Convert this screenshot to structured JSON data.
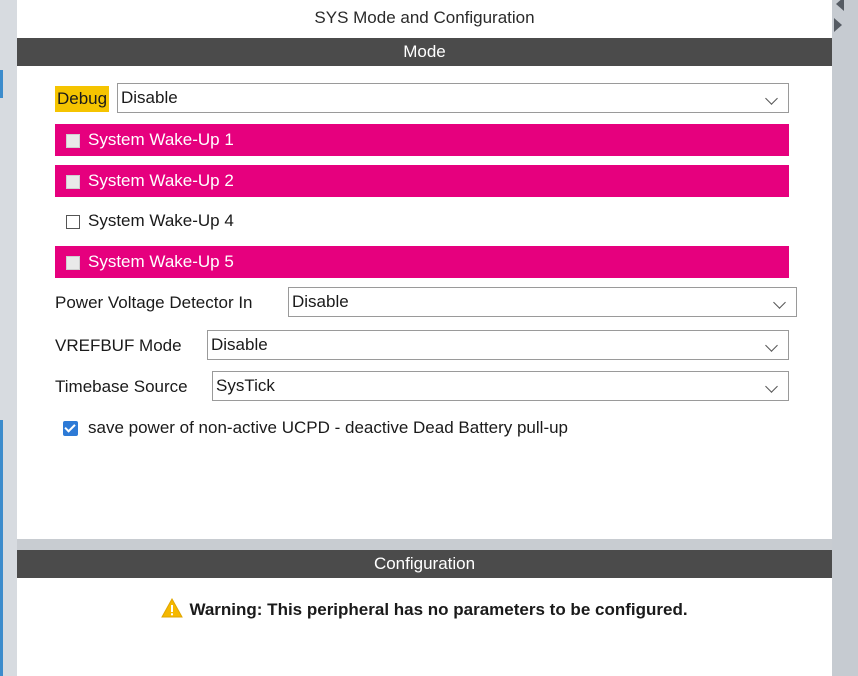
{
  "panel": {
    "title": "SYS Mode and Configuration"
  },
  "mode_section": {
    "title": "Mode"
  },
  "debug": {
    "label": "Debug",
    "value": "Disable"
  },
  "wakeups": [
    {
      "label": "System Wake-Up 1",
      "state": "highlighted"
    },
    {
      "label": "System Wake-Up 2",
      "state": "highlighted"
    },
    {
      "label": "System Wake-Up 4",
      "state": "unchecked"
    },
    {
      "label": "System Wake-Up 5",
      "state": "highlighted"
    }
  ],
  "pvd": {
    "label": "Power Voltage Detector In",
    "value": "Disable"
  },
  "vrefbuf": {
    "label": "VREFBUF Mode",
    "value": "Disable"
  },
  "timebase": {
    "label": "Timebase Source",
    "value": "SysTick"
  },
  "ucpd": {
    "label": "save power of non-active UCPD - deactive Dead Battery pull-up",
    "checked": true
  },
  "config_section": {
    "title": "Configuration"
  },
  "warning": {
    "text": "Warning: This peripheral has no parameters to be configured.",
    "icon": "warning-icon"
  },
  "colors": {
    "accent_pink": "#e6007e",
    "debug_highlight": "#f5c400",
    "header_bar": "#4b4b4b",
    "checkbox_blue": "#2d7ad6"
  }
}
